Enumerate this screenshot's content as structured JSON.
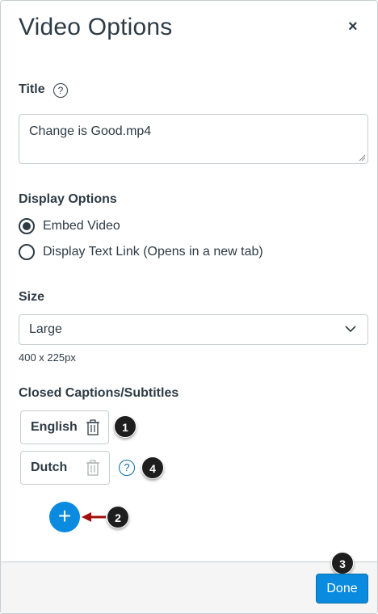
{
  "dialog": {
    "title": "Video Options",
    "close_glyph": "×"
  },
  "title_field": {
    "label": "Title",
    "help_glyph": "?",
    "value": "Change is Good.mp4"
  },
  "display_options": {
    "label": "Display Options",
    "options": [
      {
        "label": "Embed Video",
        "checked": true
      },
      {
        "label": "Display Text Link (Opens in a new tab)",
        "checked": false
      }
    ]
  },
  "size": {
    "label": "Size",
    "selected": "Large",
    "dimensions": "400 x 225px"
  },
  "captions": {
    "label": "Closed Captions/Subtitles",
    "items": [
      {
        "language": "English"
      },
      {
        "language": "Dutch"
      }
    ],
    "help_glyph": "?",
    "add_glyph": "+"
  },
  "callouts": [
    "1",
    "2",
    "3",
    "4"
  ],
  "footer": {
    "done_label": "Done"
  },
  "colors": {
    "text": "#2d3b45",
    "primary": "#0b8be0",
    "link": "#0770a3",
    "border": "#c7cdd1",
    "callout": "#1e1e1e",
    "arrow": "#a30f0f",
    "footer_bg": "#f5f5f5"
  }
}
